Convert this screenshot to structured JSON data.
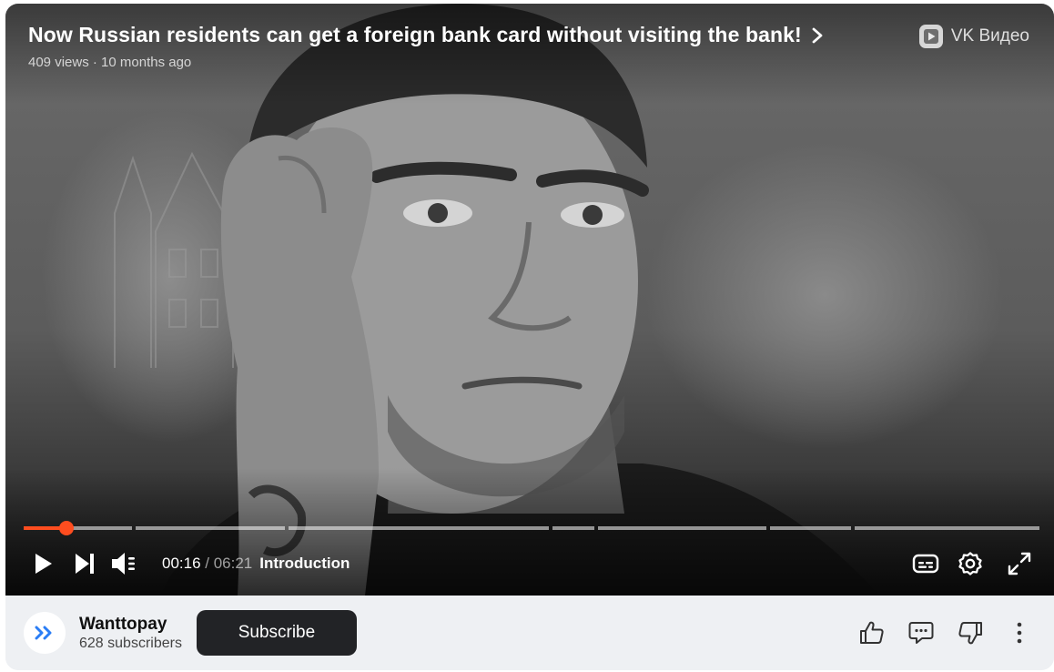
{
  "video": {
    "title": "Now Russian residents can get a foreign bank card without visiting the bank!",
    "meta": "409 views · 10 months ago"
  },
  "brand": {
    "label": "VK Видео",
    "icon": "vk-video-logo-icon"
  },
  "player": {
    "current_time": "00:16",
    "separator": " / ",
    "duration": "06:21",
    "chapter": "Introduction",
    "progress_fraction": 0.042,
    "accent_color": "#ff4d1f",
    "icons": [
      "play-icon",
      "next-icon",
      "volume-icon",
      "subtitles-icon",
      "settings-icon",
      "fullscreen-icon"
    ]
  },
  "channel": {
    "name": "Wanttopay",
    "subscribers": "628 subscribers",
    "subscribe_label": "Subscribe",
    "avatar_icon": "double-chevron-icon",
    "avatar_color": "#2a7df5"
  },
  "actions": {
    "icons": [
      "thumbs-up-icon",
      "comment-icon",
      "thumbs-down-icon",
      "more-icon"
    ]
  }
}
